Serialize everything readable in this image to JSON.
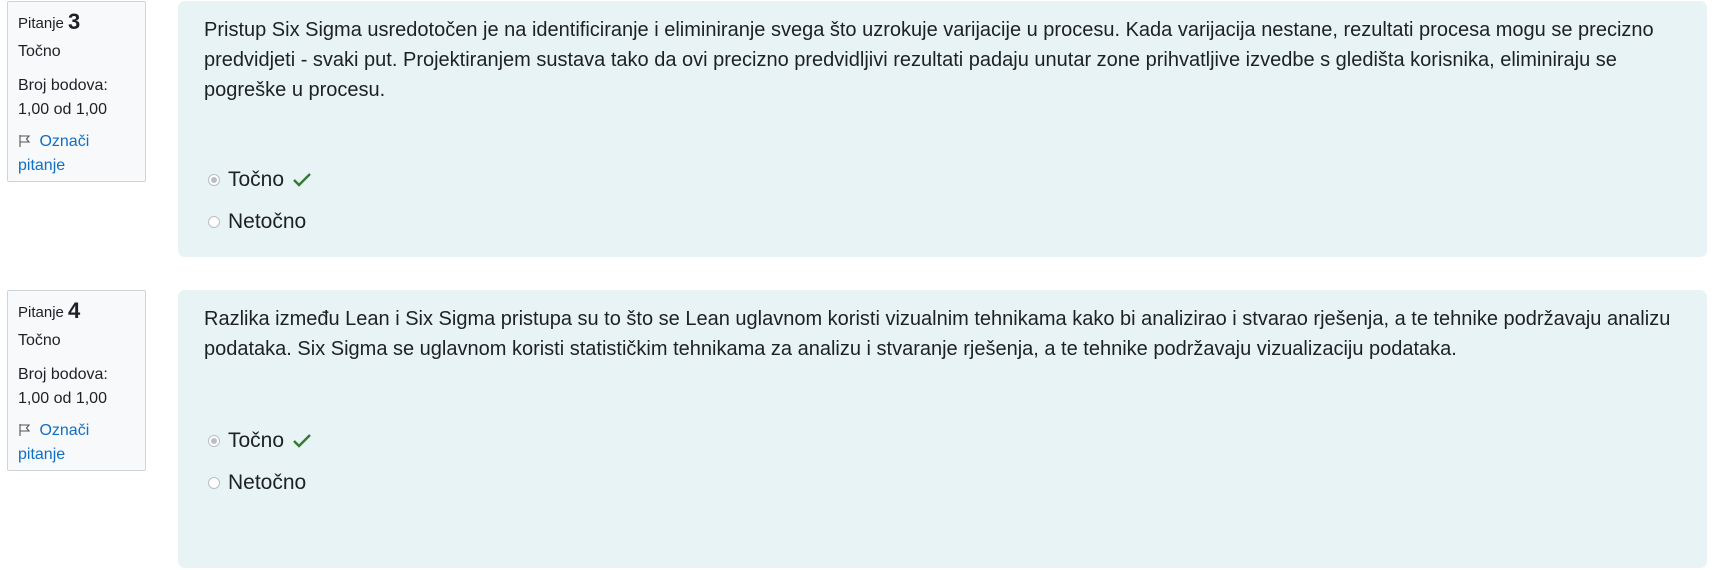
{
  "questions": [
    {
      "label": "Pitanje",
      "number": "3",
      "state": "Točno",
      "grade_label": "Broj bodova:",
      "grade_value": "1,00 od 1,00",
      "flag_line1": "Označi",
      "flag_line2": "pitanje",
      "text": "Pristup Six Sigma usredotočen je na identificiranje i eliminiranje svega što uzrokuje varijacije u procesu. Kada varijacija nestane, rezultati procesa mogu se precizno predvidjeti - svaki put. Projektiranjem sustava tako da ovi precizno predvidljivi rezultati padaju unutar zone prihvatljive izvedbe s gledišta korisnika, eliminiraju se pogreške u procesu.",
      "options": [
        {
          "label": "Točno",
          "selected": true,
          "correct": true
        },
        {
          "label": "Netočno",
          "selected": false,
          "correct": false
        }
      ]
    },
    {
      "label": "Pitanje",
      "number": "4",
      "state": "Točno",
      "grade_label": "Broj bodova:",
      "grade_value": "1,00 od 1,00",
      "flag_line1": "Označi",
      "flag_line2": "pitanje",
      "text": "Razlika između Lean i Six Sigma pristupa su to što se Lean uglavnom koristi vizualnim tehnikama kako bi analizirao i stvarao rješenja, a te tehnike podržavaju analizu podataka. Six Sigma se uglavnom koristi statističkim tehnikama za analizu i stvaranje rješenja, a te tehnike podržavaju vizualizaciju podataka.",
      "options": [
        {
          "label": "Točno",
          "selected": true,
          "correct": true
        },
        {
          "label": "Netočno",
          "selected": false,
          "correct": false
        }
      ]
    }
  ],
  "colors": {
    "accent": "#0f6fc5",
    "correct": "#357a32",
    "panel": "#e7f3f5"
  },
  "icons": {
    "flag": "flag-icon",
    "correct": "check-icon"
  }
}
